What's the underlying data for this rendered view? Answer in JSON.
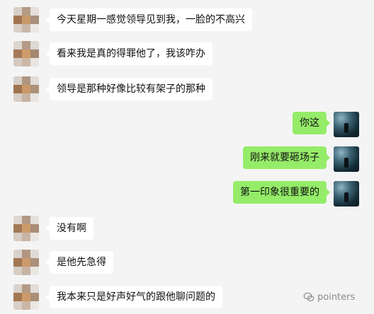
{
  "messages": [
    {
      "side": "left",
      "text": "今天星期一感觉领导见到我，一脸的不高兴"
    },
    {
      "side": "left",
      "text": "看来我是真的得罪他了，我该咋办"
    },
    {
      "side": "left",
      "text": "领导是那种好像比较有架子的那种"
    },
    {
      "side": "right",
      "text": "你这"
    },
    {
      "side": "right",
      "text": "刚来就要砸场子"
    },
    {
      "side": "right",
      "text": "第一印象很重要的"
    },
    {
      "side": "left",
      "text": "没有啊"
    },
    {
      "side": "left",
      "text": "是他先急得"
    },
    {
      "side": "left",
      "text": "我本来只是好声好气的跟他聊问题的"
    }
  ],
  "watermark": {
    "label": "pointers",
    "icon": "wechat-icon"
  },
  "colors": {
    "background": "#f4f4f5",
    "self_bubble": "#95ec69",
    "other_bubble": "#ffffff"
  }
}
